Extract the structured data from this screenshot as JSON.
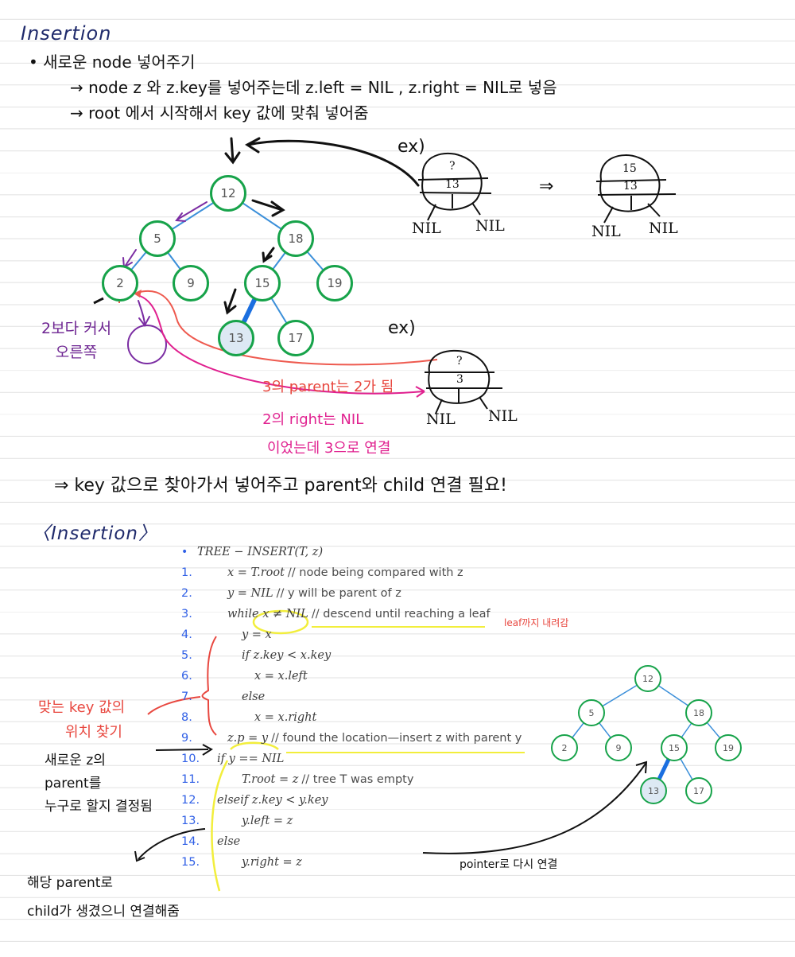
{
  "notes": {
    "title": "Insertion",
    "bullet": "새로운 node 넣어주기",
    "step1": "→ node z 와 z.key를 넣어주는데  z.left = NIL , z.right = NIL로 넣음",
    "step2": "→ root 에서 시작해서  key 값에 맞춰 넣어줌",
    "ex_label_1": "ex)",
    "ex_label_2": "ex)",
    "implies": "⇒",
    "conclusion": "⇒  key 값으로 찾아가서  넣어주고  parent와 child 연결 필요!",
    "ann_two_bigger": [
      "2보다 커서",
      "오른쪽"
    ],
    "ann_parent": "3의 parent는 2가 됨",
    "ann_right": [
      "2의 right는 NIL",
      "이었는데 3으로 연결"
    ]
  },
  "tree_top": {
    "nodes": [
      "12",
      "5",
      "18",
      "2",
      "9",
      "15",
      "19",
      "13",
      "17"
    ]
  },
  "ex_nodes": {
    "ex1_before": {
      "top": "?",
      "key": "13",
      "left": "NIL",
      "right": "NIL"
    },
    "ex1_after": {
      "top": "15",
      "key": "13",
      "left": "NIL",
      "right": "NIL"
    },
    "ex2": {
      "top": "?",
      "key": "3",
      "left": "NIL",
      "right": "NIL"
    }
  },
  "code": {
    "section_title": "〈Insertion〉",
    "header": "TREE − INSERT(T, z)",
    "lines": [
      {
        "num": "1.",
        "code": "x = T.root",
        "comment": "// node being compared with z"
      },
      {
        "num": "2.",
        "code": "y = NIL",
        "comment": "// y will be parent of z"
      },
      {
        "num": "3.",
        "code": "while x ≠ NIL",
        "comment": "// descend until reaching a leaf"
      },
      {
        "num": "4.",
        "code": "y = x",
        "comment": ""
      },
      {
        "num": "5.",
        "code": "if z.key < x.key",
        "comment": ""
      },
      {
        "num": "6.",
        "code": "x = x.left",
        "comment": ""
      },
      {
        "num": "7.",
        "code": "else",
        "comment": ""
      },
      {
        "num": "8.",
        "code": "x = x.right",
        "comment": ""
      },
      {
        "num": "9.",
        "code": "z.p = y",
        "comment": "// found the location—insert z with parent y"
      },
      {
        "num": "10.",
        "code": "if y == NIL",
        "comment": ""
      },
      {
        "num": "11.",
        "code": "T.root = z",
        "comment": "// tree T was empty"
      },
      {
        "num": "12.",
        "code": "elseif z.key < y.key",
        "comment": ""
      },
      {
        "num": "13.",
        "code": "y.left = z",
        "comment": ""
      },
      {
        "num": "14.",
        "code": "else",
        "comment": ""
      },
      {
        "num": "15.",
        "code": "y.right = z",
        "comment": ""
      }
    ],
    "ann_leaf": "leaf까지 내려감",
    "ann_find": [
      "맞는 key 값의",
      "위치 찾기"
    ],
    "ann_new_parent": [
      "새로운 z의",
      "parent를",
      "누구로 할지 결정됨"
    ],
    "ann_connect": [
      "해당 parent로",
      "child가 생겼으니 연결해줌"
    ],
    "ann_pointer": "pointer로 다시 연결"
  },
  "tree_bottom": {
    "nodes": [
      "12",
      "5",
      "18",
      "2",
      "9",
      "15",
      "19",
      "13",
      "17"
    ]
  },
  "colors": {
    "node_border": "#17a34a",
    "edge": "#3b8fd9",
    "highlight_fill": "#dde9f4",
    "line_number": "#2f5fe6",
    "ink_navy": "#1f2a6b",
    "ink_red": "#e8473f",
    "ink_magenta": "#e0208f",
    "ink_purple": "#6e2592",
    "highlighter": "#f2ee3c"
  }
}
